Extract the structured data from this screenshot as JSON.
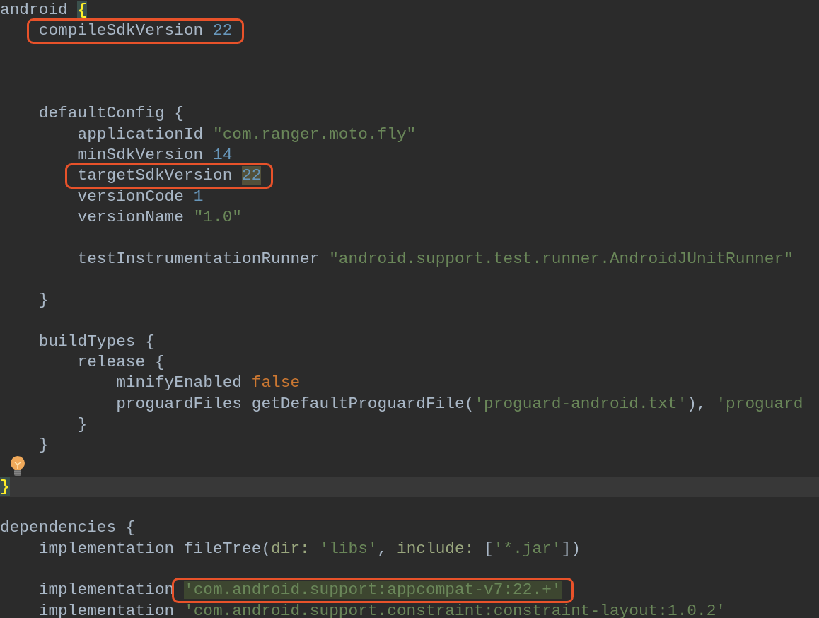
{
  "editor": {
    "lines": [
      {
        "kind": "code",
        "current": false,
        "segments": [
          {
            "boxed": false,
            "tokens": [
              {
                "text": "android ",
                "kind": "plain"
              },
              {
                "text": "{",
                "kind": "brace"
              }
            ]
          }
        ]
      },
      {
        "kind": "code",
        "current": false,
        "segments": [
          {
            "boxed": true,
            "tokens": [
              {
                "text": "    compileSdkVersion ",
                "kind": "plain"
              },
              {
                "text": "22",
                "kind": "number"
              }
            ]
          }
        ]
      },
      {
        "kind": "blank",
        "current": false
      },
      {
        "kind": "blank",
        "current": false
      },
      {
        "kind": "blank",
        "current": false
      },
      {
        "kind": "code",
        "current": false,
        "segments": [
          {
            "boxed": false,
            "tokens": [
              {
                "text": "    defaultConfig {",
                "kind": "plain"
              }
            ]
          }
        ]
      },
      {
        "kind": "code",
        "current": false,
        "segments": [
          {
            "boxed": false,
            "tokens": [
              {
                "text": "        applicationId ",
                "kind": "plain"
              },
              {
                "text": "\"com.ranger.moto.fly\"",
                "kind": "string"
              }
            ]
          }
        ]
      },
      {
        "kind": "code",
        "current": false,
        "segments": [
          {
            "boxed": false,
            "tokens": [
              {
                "text": "        minSdkVersion ",
                "kind": "plain"
              },
              {
                "text": "14",
                "kind": "number"
              }
            ]
          }
        ]
      },
      {
        "kind": "code",
        "current": false,
        "segments": [
          {
            "boxed": true,
            "tokens": [
              {
                "text": "        targetSdkVersion ",
                "kind": "plain"
              },
              {
                "text": "22",
                "kind": "number_usage"
              }
            ]
          }
        ]
      },
      {
        "kind": "code",
        "current": false,
        "segments": [
          {
            "boxed": false,
            "tokens": [
              {
                "text": "        versionCode ",
                "kind": "plain"
              },
              {
                "text": "1",
                "kind": "number"
              }
            ]
          }
        ]
      },
      {
        "kind": "code",
        "current": false,
        "segments": [
          {
            "boxed": false,
            "tokens": [
              {
                "text": "        versionName ",
                "kind": "plain"
              },
              {
                "text": "\"1.0\"",
                "kind": "string"
              }
            ]
          }
        ]
      },
      {
        "kind": "blank",
        "current": false
      },
      {
        "kind": "code",
        "current": false,
        "segments": [
          {
            "boxed": false,
            "tokens": [
              {
                "text": "        testInstrumentationRunner ",
                "kind": "plain"
              },
              {
                "text": "\"android.support.test.runner.AndroidJUnitRunner\"",
                "kind": "string"
              }
            ]
          }
        ]
      },
      {
        "kind": "blank",
        "current": false
      },
      {
        "kind": "code",
        "current": false,
        "segments": [
          {
            "boxed": false,
            "tokens": [
              {
                "text": "    }",
                "kind": "plain"
              }
            ]
          }
        ]
      },
      {
        "kind": "blank",
        "current": false
      },
      {
        "kind": "code",
        "current": false,
        "segments": [
          {
            "boxed": false,
            "tokens": [
              {
                "text": "    buildTypes {",
                "kind": "plain"
              }
            ]
          }
        ]
      },
      {
        "kind": "code",
        "current": false,
        "segments": [
          {
            "boxed": false,
            "tokens": [
              {
                "text": "        release {",
                "kind": "plain"
              }
            ]
          }
        ]
      },
      {
        "kind": "code",
        "current": false,
        "segments": [
          {
            "boxed": false,
            "tokens": [
              {
                "text": "            minifyEnabled ",
                "kind": "plain"
              },
              {
                "text": "false",
                "kind": "keyword"
              }
            ]
          }
        ]
      },
      {
        "kind": "code",
        "current": false,
        "segments": [
          {
            "boxed": false,
            "tokens": [
              {
                "text": "            proguardFiles getDefaultProguardFile(",
                "kind": "plain"
              },
              {
                "text": "'proguard-android.txt'",
                "kind": "string"
              },
              {
                "text": "), ",
                "kind": "plain"
              },
              {
                "text": "'proguard",
                "kind": "string"
              }
            ]
          }
        ]
      },
      {
        "kind": "code",
        "current": false,
        "segments": [
          {
            "boxed": false,
            "tokens": [
              {
                "text": "        }",
                "kind": "plain"
              }
            ]
          }
        ]
      },
      {
        "kind": "code",
        "current": false,
        "segments": [
          {
            "boxed": false,
            "tokens": [
              {
                "text": "    }",
                "kind": "plain"
              }
            ]
          }
        ]
      },
      {
        "kind": "hint",
        "current": false
      },
      {
        "kind": "code",
        "current": true,
        "segments": [
          {
            "boxed": false,
            "tokens": [
              {
                "text": "}",
                "kind": "brace"
              }
            ]
          }
        ]
      },
      {
        "kind": "blank",
        "current": false
      },
      {
        "kind": "code",
        "current": false,
        "segments": [
          {
            "boxed": false,
            "tokens": [
              {
                "text": "dependencies {",
                "kind": "plain"
              }
            ]
          }
        ]
      },
      {
        "kind": "code",
        "current": false,
        "segments": [
          {
            "boxed": false,
            "tokens": [
              {
                "text": "    implementation fileTree(",
                "kind": "plain"
              },
              {
                "text": "dir: ",
                "kind": "named_arg"
              },
              {
                "text": "'libs'",
                "kind": "string"
              },
              {
                "text": ", ",
                "kind": "plain"
              },
              {
                "text": "include: ",
                "kind": "named_arg"
              },
              {
                "text": "[",
                "kind": "plain"
              },
              {
                "text": "'*.jar'",
                "kind": "string"
              },
              {
                "text": "])",
                "kind": "plain"
              }
            ]
          }
        ]
      },
      {
        "kind": "blank",
        "current": false
      },
      {
        "kind": "code",
        "current": false,
        "segments": [
          {
            "boxed": false,
            "tokens": [
              {
                "text": "    implementation ",
                "kind": "plain"
              }
            ]
          },
          {
            "boxed": true,
            "tokens": [
              {
                "text": "'com.android.support:appcompat-v7:22.+'",
                "kind": "string_usage"
              }
            ]
          }
        ]
      },
      {
        "kind": "code",
        "current": false,
        "segments": [
          {
            "boxed": false,
            "tokens": [
              {
                "text": "    implementation ",
                "kind": "plain"
              },
              {
                "text": "'com.android.support.constraint:constraint-layout:1.0.2'",
                "kind": "string"
              }
            ]
          }
        ]
      }
    ]
  }
}
